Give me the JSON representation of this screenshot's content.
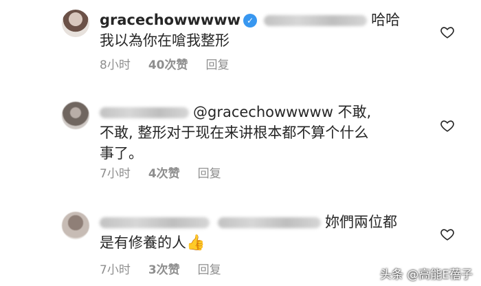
{
  "comments": [
    {
      "username": "gracechowwwww",
      "verified_glyph": "✓",
      "text_line1_suffix": "哈哈",
      "text_line2": "我以為你在嗆我整形",
      "time": "8小时",
      "likes": "40次赞",
      "reply": "回复"
    },
    {
      "mention": "@gracechowwwww 不敢,",
      "text_line2": "不敢, 整形对于现在来讲根本都不算个什么",
      "text_line3": "事了。",
      "time": "7小时",
      "likes": "4次赞",
      "reply": "回复"
    },
    {
      "text_line1_suffix": "妳們兩位都",
      "text_line2": "是有修養的人",
      "emoji": "👍",
      "time": "7小时",
      "likes": "3次赞",
      "reply": "回复"
    }
  ],
  "watermark": "头条 @高能E蓓子",
  "icons": {
    "heart": "heart-outline-icon",
    "verified": "verified-badge-icon"
  }
}
